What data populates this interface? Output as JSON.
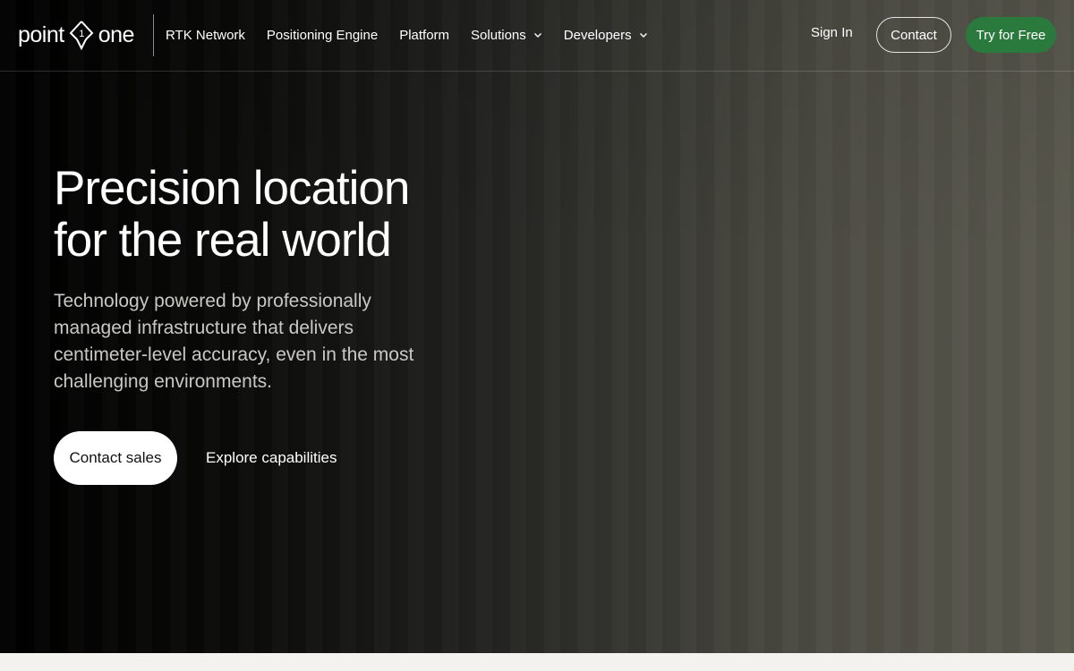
{
  "header": {
    "logo_left": "point",
    "logo_mid": "1",
    "logo_right": "one",
    "nav": [
      {
        "label": "RTK Network",
        "dropdown": false
      },
      {
        "label": "Positioning Engine",
        "dropdown": false
      },
      {
        "label": "Platform",
        "dropdown": false
      },
      {
        "label": "Solutions",
        "dropdown": true
      },
      {
        "label": "Developers",
        "dropdown": true
      }
    ],
    "sign_in": "Sign In",
    "contact": "Contact",
    "try_free": "Try for Free"
  },
  "hero": {
    "title_line1": "Precision location",
    "title_line2": "for the real world",
    "subtitle": "Technology powered by professionally managed infrastructure that delivers centimeter-level accuracy, even in the most challenging environments.",
    "primary_cta": "Contact sales",
    "secondary_cta": "Explore capabilities"
  },
  "colors": {
    "accent_green": "#2b7a3d",
    "page_bg": "#f4f2ee"
  },
  "icons": {
    "logo_mark": "diamond-pin-icon",
    "dropdown": "chevron-down-icon"
  }
}
